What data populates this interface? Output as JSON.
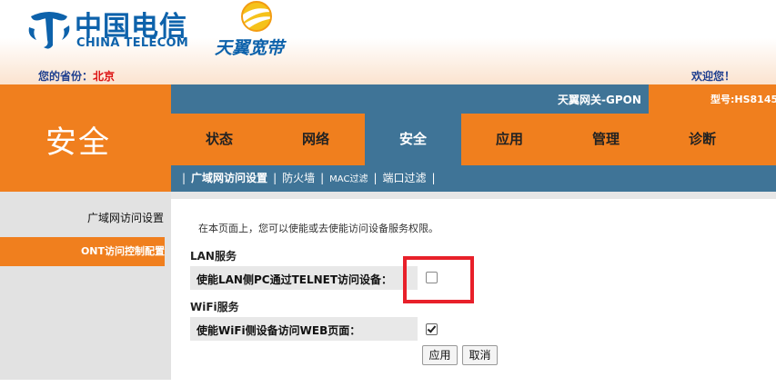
{
  "header": {
    "brand_cn": "中国电信",
    "brand_en": "CHINA TELECOM",
    "product_name": "天翼宽带",
    "province_label": "您的省份：",
    "province_value": "北京",
    "welcome": "欢迎您！"
  },
  "topbar": {
    "gateway_name": "天翼网关-GPON",
    "model": "型号:HS8145"
  },
  "section": {
    "title": "安全"
  },
  "tabs": [
    {
      "label": "状态"
    },
    {
      "label": "网络"
    },
    {
      "label": "安全",
      "active": true
    },
    {
      "label": "应用"
    },
    {
      "label": "管理"
    },
    {
      "label": "诊断"
    }
  ],
  "subnav": {
    "items": [
      {
        "label": "广域网访问设置",
        "active": true
      },
      {
        "label": "防火墙"
      },
      {
        "label": "MAC过滤"
      },
      {
        "label": "端口过滤"
      }
    ]
  },
  "sidebar": {
    "items": [
      {
        "label": "广域网访问设置"
      },
      {
        "label": "ONT访问控制配置",
        "active": true
      }
    ]
  },
  "content": {
    "description": "在本页面上，您可以使能或去使能访问设备服务权限。",
    "lan_section_title": "LAN服务",
    "lan_telnet_label": "使能LAN侧PC通过TELNET访问设备：",
    "lan_telnet_checked": false,
    "wifi_section_title": "WiFi服务",
    "wifi_web_label": "使能WiFi侧设备访问WEB页面：",
    "wifi_web_checked": true,
    "apply_label": "应用",
    "cancel_label": "取消"
  },
  "colors": {
    "orange": "#f07f1e",
    "steel_blue": "#3f7497",
    "brand_blue": "#0d62ab",
    "highlight_red": "#e8202a"
  },
  "icons": [
    "china-telecom-logo-icon",
    "tianyi-logo-icon",
    "checkbox-icon"
  ]
}
